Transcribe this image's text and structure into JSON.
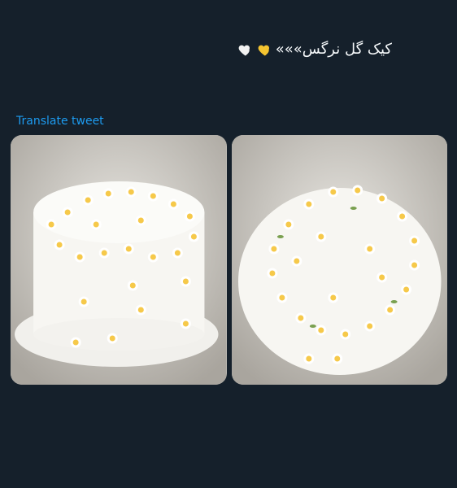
{
  "tweet": {
    "text": "کیک گل نرگس»»»",
    "emojis": [
      "yellow-heart-icon",
      "white-heart-icon"
    ],
    "translate_label": "Translate tweet"
  },
  "media": {
    "images": [
      "cake-photo-side-view",
      "cake-photo-top-view"
    ]
  },
  "colors": {
    "background": "#15202b",
    "link": "#1d9bf0",
    "text": "#f5f8fa",
    "yellow_heart": "#f4c430",
    "white_heart": "#f2f2f2"
  }
}
